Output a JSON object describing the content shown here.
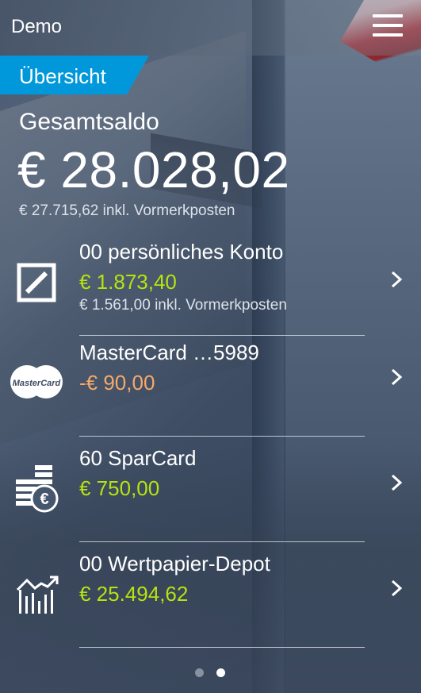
{
  "header": {
    "title": "Demo",
    "menu_icon": "hamburger-menu-icon"
  },
  "tab": {
    "label": "Übersicht",
    "color": "#0098db"
  },
  "summary": {
    "label": "Gesamtsaldo",
    "amount": "€ 28.028,02",
    "pending": "€ 27.715,62 inkl. Vormerkposten"
  },
  "accounts": [
    {
      "icon": "deutsche-bank-logo-icon",
      "name": "00 persönliches Konto",
      "balance": "€ 1.873,40",
      "pending": "€ 1.561,00 inkl. Vormerkposten"
    },
    {
      "icon": "mastercard-logo-icon",
      "name": "MasterCard …5989",
      "balance": "-€ 90,00",
      "logo_text": "MasterCard"
    },
    {
      "icon": "euro-coins-icon",
      "name": "60 SparCard",
      "balance": "€ 750,00"
    },
    {
      "icon": "chart-growth-icon",
      "name": "00 Wertpapier-Depot",
      "balance": "€ 25.494,62"
    }
  ],
  "colors": {
    "positive": "#b6e40f",
    "negative": "#f5a96a",
    "accent": "#0098db"
  },
  "pager": {
    "pages": 2,
    "active": 2
  }
}
